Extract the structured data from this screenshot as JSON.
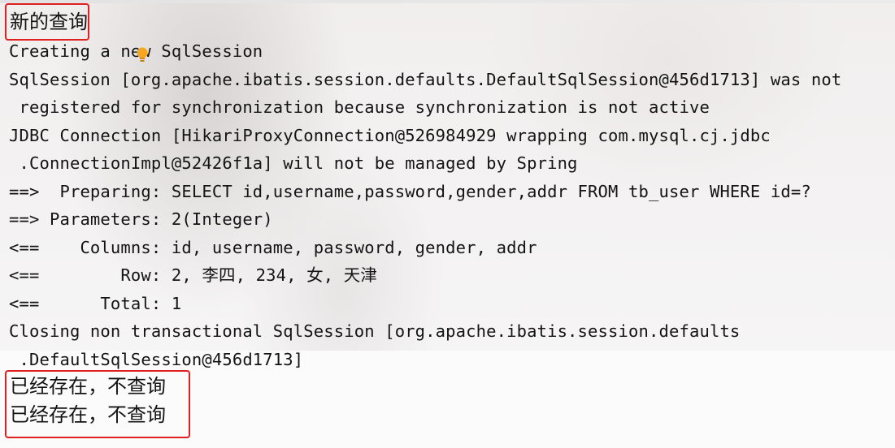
{
  "console": {
    "header_label": "新的查询",
    "lines": [
      "Creating a new SqlSession",
      "SqlSession [org.apache.ibatis.session.defaults.DefaultSqlSession@456d1713] was not",
      " registered for synchronization because synchronization is not active",
      "JDBC Connection [HikariProxyConnection@526984929 wrapping com.mysql.cj.jdbc",
      " .ConnectionImpl@52426f1a] will not be managed by Spring",
      "==>  Preparing: SELECT id,username,password,gender,addr FROM tb_user WHERE id=?",
      "==> Parameters: 2(Integer)",
      "<==    Columns: id, username, password, gender, addr",
      "<==        Row: 2, 李四, 234, 女, 天津",
      "<==      Total: 1",
      "Closing non transactional SqlSession [org.apache.ibatis.session.defaults",
      " .DefaultSqlSession@456d1713]"
    ],
    "footer_lines": [
      "已经存在，不查询",
      "已经存在，不查询"
    ]
  },
  "colors": {
    "highlight_box": "#e02020",
    "text": "#141414",
    "cursor_bulb": "#f5a623"
  },
  "icons": {
    "cursor": "lightbulb-cursor-icon"
  }
}
